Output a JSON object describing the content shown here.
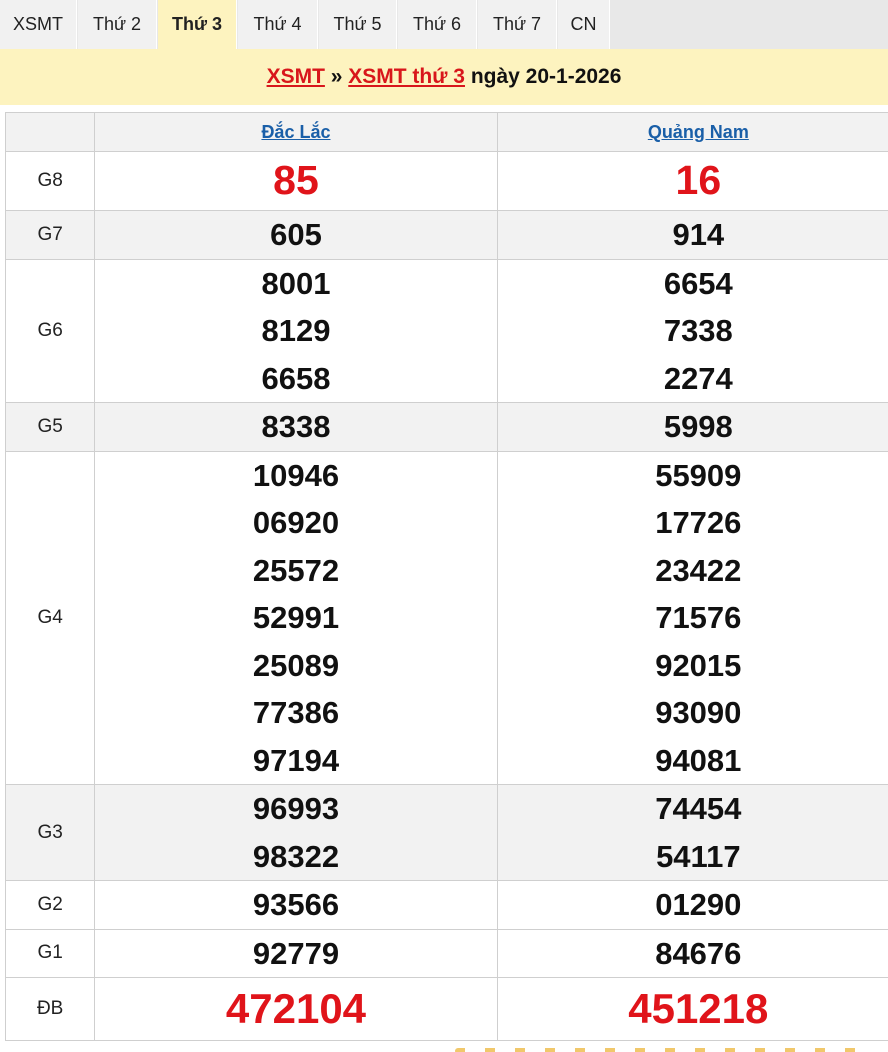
{
  "tabs": [
    {
      "label": "XSMT",
      "active": false
    },
    {
      "label": "Thứ 2",
      "active": false
    },
    {
      "label": "Thứ 3",
      "active": true
    },
    {
      "label": "Thứ 4",
      "active": false
    },
    {
      "label": "Thứ 5",
      "active": false
    },
    {
      "label": "Thứ 6",
      "active": false
    },
    {
      "label": "Thứ 7",
      "active": false
    },
    {
      "label": "CN",
      "active": false
    }
  ],
  "banner": {
    "link1": "XSMT",
    "separator": " » ",
    "link2": "XSMT thứ 3",
    "date_text": " ngày 20-1-2026"
  },
  "provinces": [
    "Đắc Lắc",
    "Quảng Nam"
  ],
  "prizes": [
    {
      "label": "G8",
      "style": "red",
      "shade": false,
      "values": [
        [
          "85"
        ],
        [
          "16"
        ]
      ]
    },
    {
      "label": "G7",
      "style": "",
      "shade": true,
      "values": [
        [
          "605"
        ],
        [
          "914"
        ]
      ]
    },
    {
      "label": "G6",
      "style": "",
      "shade": false,
      "values": [
        [
          "8001",
          "8129",
          "6658"
        ],
        [
          "6654",
          "7338",
          "2274"
        ]
      ]
    },
    {
      "label": "G5",
      "style": "",
      "shade": true,
      "values": [
        [
          "8338"
        ],
        [
          "5998"
        ]
      ]
    },
    {
      "label": "G4",
      "style": "",
      "shade": false,
      "values": [
        [
          "10946",
          "06920",
          "25572",
          "52991",
          "25089",
          "77386",
          "97194"
        ],
        [
          "55909",
          "17726",
          "23422",
          "71576",
          "92015",
          "93090",
          "94081"
        ]
      ]
    },
    {
      "label": "G3",
      "style": "",
      "shade": true,
      "values": [
        [
          "96993",
          "98322"
        ],
        [
          "74454",
          "54117"
        ]
      ]
    },
    {
      "label": "G2",
      "style": "",
      "shade": false,
      "values": [
        [
          "93566"
        ],
        [
          "01290"
        ]
      ]
    },
    {
      "label": "G1",
      "style": "",
      "shade": false,
      "values": [
        [
          "92779"
        ],
        [
          "84676"
        ]
      ]
    },
    {
      "label": "ĐB",
      "style": "big",
      "shade": false,
      "values": [
        [
          "472104"
        ],
        [
          "451218"
        ]
      ]
    }
  ],
  "colors": {
    "accent_red": "#e0141a",
    "banner_bg": "#fdf3bf",
    "link_blue": "#1a5fa8"
  }
}
